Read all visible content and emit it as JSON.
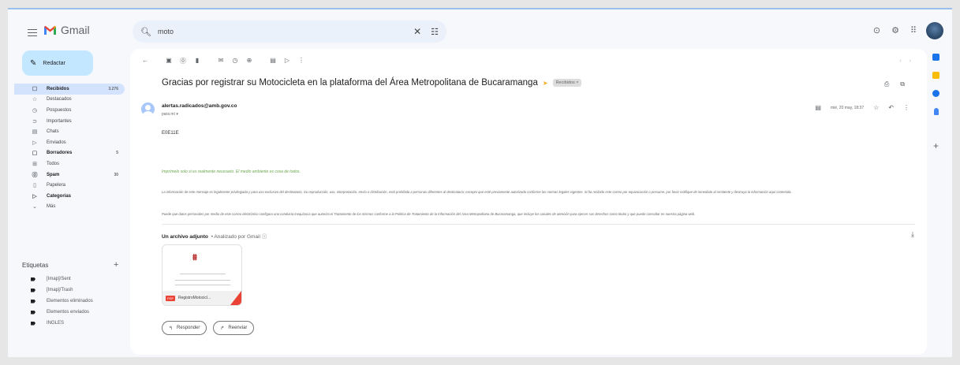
{
  "app": {
    "name": "Gmail"
  },
  "search": {
    "value": "moto"
  },
  "compose": {
    "label": "Redactar"
  },
  "nav": [
    {
      "name": "nav-inbox",
      "icon": "☐",
      "label": "Recibidos",
      "count": "3.276",
      "bold": true,
      "active": true
    },
    {
      "name": "nav-starred",
      "icon": "☆",
      "label": "Destacados",
      "count": "",
      "bold": false
    },
    {
      "name": "nav-snoozed",
      "icon": "◷",
      "label": "Pospuestos",
      "count": "",
      "bold": false
    },
    {
      "name": "nav-important",
      "icon": "⊃",
      "label": "Importantes",
      "count": "",
      "bold": false
    },
    {
      "name": "nav-chats",
      "icon": "▤",
      "label": "Chats",
      "count": "",
      "bold": false
    },
    {
      "name": "nav-sent",
      "icon": "▷",
      "label": "Enviados",
      "count": "",
      "bold": false
    },
    {
      "name": "nav-drafts",
      "icon": "▢",
      "label": "Borradores",
      "count": "5",
      "bold": true
    },
    {
      "name": "nav-all",
      "icon": "⊞",
      "label": "Todos",
      "count": "",
      "bold": false
    },
    {
      "name": "nav-spam",
      "icon": "⓪",
      "label": "Spam",
      "count": "30",
      "bold": true
    },
    {
      "name": "nav-trash",
      "icon": "▯",
      "label": "Papelera",
      "count": "",
      "bold": false
    },
    {
      "name": "nav-categories",
      "icon": "▷",
      "label": "Categorías",
      "count": "",
      "bold": true
    },
    {
      "name": "nav-more",
      "icon": "⌄",
      "label": "Más",
      "count": "",
      "bold": false
    }
  ],
  "labels": {
    "title": "Etiquetas",
    "items": [
      "[Imap]/Sent",
      "[Imap]/Trash",
      "Elementos eliminados",
      "Elementos enviados",
      "INGLES"
    ]
  },
  "email": {
    "subject": "Gracias por registrar su Motocicleta en la plataforma del Área Metropolitana de Bucaramanga",
    "badge": "Recibidos ×",
    "sender": "alertas.radicados@amb.gov.co",
    "to": "para mí ▾",
    "date": "mié, 20 may, 18:37",
    "code": "E0E11E",
    "green_note": "Imprímelo solo si es realmente necesario. El medio ambiente es cosa de todos.",
    "legal_1": "La información de este mensaje es legalmente privilegiada y para uso exclusivo del destinatario. Su reproducción, uso, interpretación, envío o distribución, está prohibida a personas diferentes al destinatario; excepto que esté previamente autorizado conforme las normas legales vigentes. Si ha recibido este correo por equivocación o presume, por favor notifique de inmediato al remitente y destruya la información aquí contenida.",
    "legal_2": "Puede que datos personales por medio de este correo electrónico configura una conducta inequívoca que autoriza el Tratamiento de los mismos conforme a la Política de Tratamiento de la Información del Área Metropolitana de Bucaramanga, que incluye los canales de atención para ejercer sus derechos como titular y que puede consultar en nuestra página web."
  },
  "attachment": {
    "title": "Un archivo adjunto",
    "analyzed": "• Analizado por Gmail ⓘ",
    "filename": "RegistroMotocicl...",
    "type_label": "PDF"
  },
  "actions": {
    "reply": "Responder",
    "forward": "Reenviar"
  },
  "colors": {
    "compose_bg": "#c2e7ff",
    "active_nav": "#d3e3fd",
    "accent_green": "#6aa84f"
  }
}
